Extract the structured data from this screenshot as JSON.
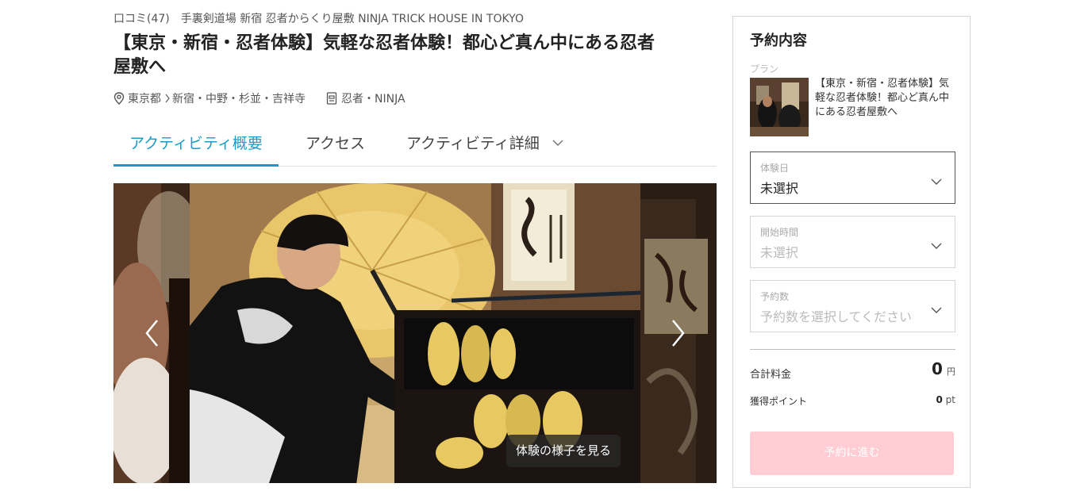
{
  "header": {
    "reviews": "口コミ(47)",
    "venue": "手裏剣道場 新宿 忍者からくり屋敷 NINJA TRICK HOUSE IN TOKYO",
    "title_line1": "【東京・新宿・忍者体験】気軽な忍者体験！都心ど真ん中にある忍者",
    "title_line2": "屋敷へ",
    "location_pref": "東京都",
    "location_area": "新宿・中野・杉並・吉祥寺",
    "category": "忍者・NINJA"
  },
  "tabs": [
    {
      "label": "アクティビティ概要",
      "active": true
    },
    {
      "label": "アクセス",
      "active": false
    },
    {
      "label": "アクティビティ詳細",
      "active": false
    }
  ],
  "gallery": {
    "view_button": "体験の様子を見る"
  },
  "booking": {
    "heading": "予約内容",
    "plan_label": "プラン",
    "plan_name": "【東京・新宿・忍者体験】気軽な忍者体験！都心ど真ん中にある忍者屋敷へ",
    "date_label": "体験日",
    "date_value": "未選択",
    "time_label": "開始時間",
    "time_value": "未選択",
    "count_label": "予約数",
    "count_placeholder": "予約数を選択してください",
    "total_label": "合計料金",
    "total_value": "0",
    "total_unit": "円",
    "points_label": "獲得ポイント",
    "points_value": "0",
    "points_unit": "pt",
    "cta": "予約に進む"
  },
  "colors": {
    "accent": "#1a9bc7",
    "cta_disabled": "#ffcdd3"
  },
  "icons": {
    "location": "map-pin-icon",
    "category": "ninja-badge-icon",
    "dropdown": "chevron-down-icon",
    "prev": "chevron-left-icon",
    "next": "chevron-right-icon"
  }
}
